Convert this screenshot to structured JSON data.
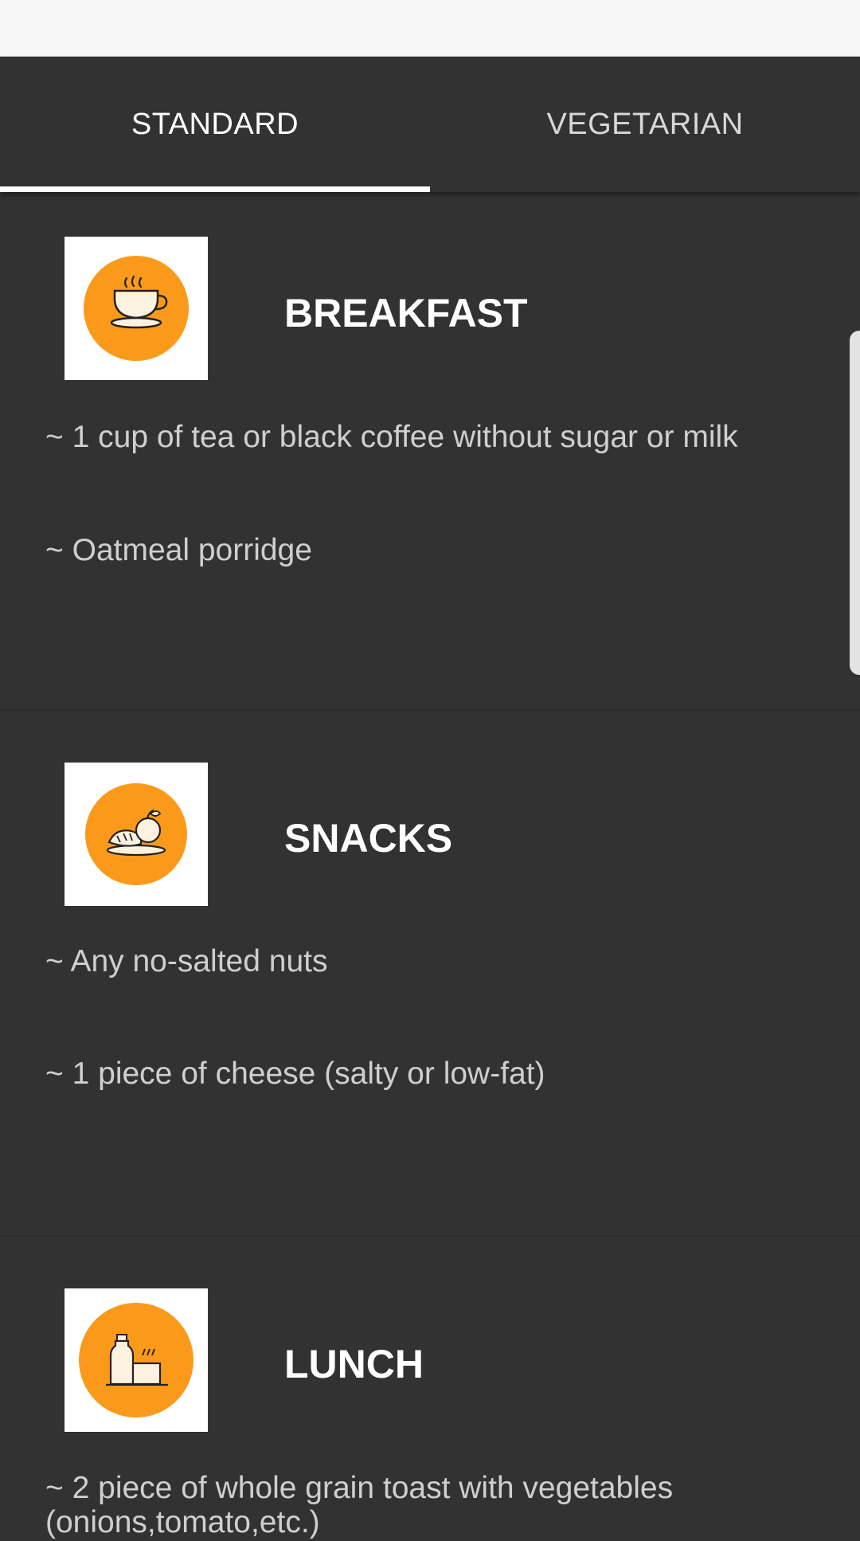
{
  "tabs": [
    {
      "label": "STANDARD",
      "selected": true
    },
    {
      "label": "VEGETARIAN",
      "selected": false
    }
  ],
  "colors": {
    "background": "#323232",
    "accent_orange": "#fb9a1a",
    "title_text": "#ffffff",
    "item_text": "#cfcfcf"
  },
  "meals": [
    {
      "title": "BREAKFAST",
      "icon": "coffee-cup-icon",
      "items": [
        "~ 1 cup of tea or black coffee without sugar or milk",
        "~ Oatmeal porridge"
      ]
    },
    {
      "title": "SNACKS",
      "icon": "snack-food-icon",
      "items": [
        "~ Any no-salted nuts",
        "~ 1 piece of cheese (salty or low-fat)"
      ]
    },
    {
      "title": "LUNCH",
      "icon": "lunch-bottle-bread-icon",
      "items": [
        "~ 2 piece of whole grain toast with vegetables",
        "(onions,tomato,etc.)"
      ]
    }
  ]
}
